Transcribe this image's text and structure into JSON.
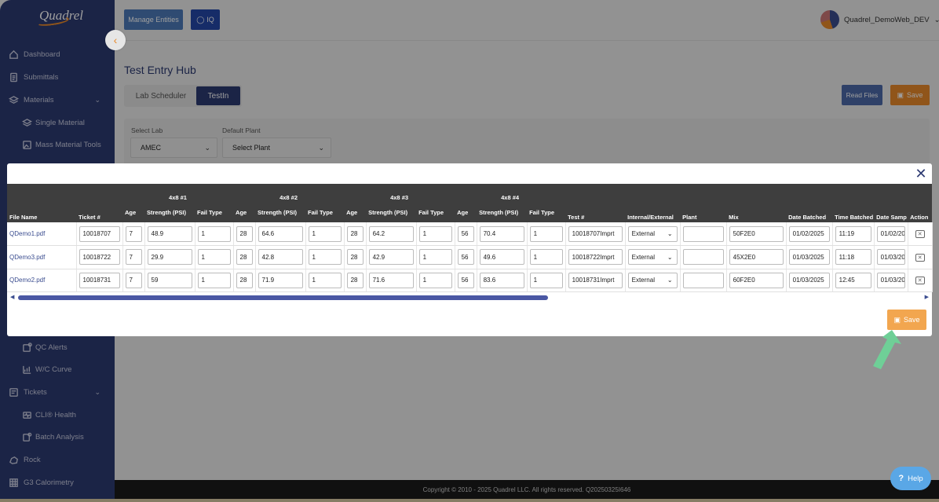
{
  "brand": {
    "logo_text": "Quadrel"
  },
  "sidebar": {
    "items": [
      {
        "label": "Dashboard",
        "icon": "home-icon"
      },
      {
        "label": "Submittals",
        "icon": "document-icon"
      },
      {
        "label": "Materials",
        "icon": "layers-icon"
      },
      {
        "label": "Single Material",
        "icon": "layers-icon"
      },
      {
        "label": "Mass Material Tools",
        "icon": "image-icon"
      },
      {
        "label": "QC Alerts",
        "icon": "alert-icon"
      },
      {
        "label": "W/C Curve",
        "icon": "chart-icon"
      },
      {
        "label": "Tickets",
        "icon": "ticket-icon"
      },
      {
        "label": "CLI® Health",
        "icon": "health-icon"
      },
      {
        "label": "Batch Analysis",
        "icon": "analysis-icon"
      },
      {
        "label": "Rock",
        "icon": "rock-icon"
      },
      {
        "label": "G3 Calorimetry",
        "icon": "grid-icon"
      }
    ]
  },
  "header": {
    "manage_entities": "Manage Entities",
    "iq": "IQ",
    "user": "Quadrel_DemoWeb_DEV"
  },
  "page": {
    "title": "Test Entry Hub",
    "tabs": [
      "Lab Scheduler",
      "TestIn"
    ],
    "read_files": "Read Files",
    "save": "Save",
    "select_lab_label": "Select Lab",
    "select_lab_value": "AMEC",
    "default_plant_label": "Default Plant",
    "default_plant_value": "Select Plant"
  },
  "modal": {
    "group_headers": [
      "4x8 #1",
      "4x8 #2",
      "4x8 #3",
      "4x8 #4"
    ],
    "columns": {
      "file_name": "File Name",
      "ticket": "Ticket #",
      "age": "Age",
      "strength": "Strength (PSI)",
      "fail_type": "Fail Type",
      "test": "Test #",
      "internal_external": "Internal/External",
      "plant": "Plant",
      "mix": "Mix",
      "date_batched": "Date Batched",
      "time_batched": "Time Batched",
      "date_sampled": "Date Samp",
      "action": "Action"
    },
    "rows": [
      {
        "file": "QDemo1.pdf",
        "ticket": "10018707",
        "a1": "7",
        "s1": "48.9",
        "f1": "1",
        "a2": "28",
        "s2": "64.6",
        "f2": "1",
        "a3": "28",
        "s3": "64.2",
        "f3": "1",
        "a4": "56",
        "s4": "70.4",
        "f4": "1",
        "test": "10018707Imprt",
        "ie": "External",
        "plant": "",
        "mix": "50F2E0",
        "date_batched": "01/02/2025",
        "time_batched": "11:19",
        "date_sampled": "01/02/20"
      },
      {
        "file": "QDemo3.pdf",
        "ticket": "10018722",
        "a1": "7",
        "s1": "29.9",
        "f1": "1",
        "a2": "28",
        "s2": "42.8",
        "f2": "1",
        "a3": "28",
        "s3": "42.9",
        "f3": "1",
        "a4": "56",
        "s4": "49.6",
        "f4": "1",
        "test": "10018722Imprt",
        "ie": "External",
        "plant": "",
        "mix": "45X2E0",
        "date_batched": "01/03/2025",
        "time_batched": "11:18",
        "date_sampled": "01/03/20"
      },
      {
        "file": "QDemo2.pdf",
        "ticket": "10018731",
        "a1": "7",
        "s1": "59",
        "f1": "1",
        "a2": "28",
        "s2": "71.9",
        "f2": "1",
        "a3": "28",
        "s3": "71.6",
        "f3": "1",
        "a4": "56",
        "s4": "83.6",
        "f4": "1",
        "test": "10018731Imprt",
        "ie": "External",
        "plant": "",
        "mix": "60F2E0",
        "date_batched": "01/03/2025",
        "time_batched": "12:45",
        "date_sampled": "01/03/20"
      }
    ],
    "save": "Save"
  },
  "footer": {
    "copyright": "Copyright © 2010 - 2025 Quadrel LLC. All rights reserved. Q20250325I646"
  },
  "help": {
    "label": "Help"
  },
  "colors": {
    "sidebar": "#2d3a72",
    "accent": "#e8892a",
    "primary": "#2447a8"
  }
}
